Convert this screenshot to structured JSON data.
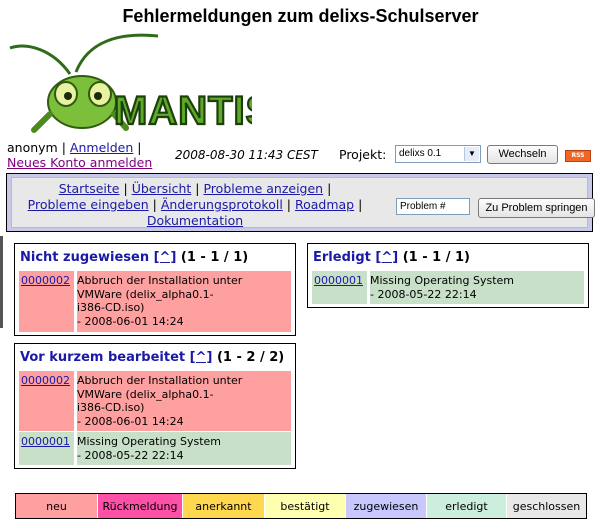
{
  "header": {
    "title": "Fehlermeldungen zum delixs-Schulserver"
  },
  "logo": {
    "text": "MANTIS"
  },
  "login": {
    "user": "anonym",
    "sep1": "|",
    "login_link": "Anmelden",
    "sep2": "|",
    "register_link": "Neues Konto anmelden"
  },
  "status": {
    "datetime": "2008-08-30 11:43 CEST",
    "project_label": "Projekt:",
    "project_value": "delixs 0.1",
    "switch_button": "Wechseln",
    "rss": "RSS"
  },
  "menu": {
    "items": [
      "Startseite",
      "Übersicht",
      "Probleme anzeigen",
      "Probleme eingeben",
      "Änderungsprotokoll",
      "Roadmap",
      "Dokumentation"
    ],
    "separator": "|",
    "problem_placeholder": "Problem #",
    "jump_button": "Zu Problem springen"
  },
  "panels": {
    "unassigned": {
      "title": "Nicht zugewiesen",
      "link": "[^]",
      "count": "(1 - 1 / 1)",
      "rows": [
        {
          "id": "0000002",
          "lines": [
            "Abbruch der Installation unter",
            "VMWare (delix_alpha0.1-",
            "i386-CD.iso)",
            "- 2008-06-01 14:24"
          ],
          "color": "#ffa0a0"
        }
      ]
    },
    "resolved": {
      "title": "Erledigt",
      "link": "[^]",
      "count": "(1 - 1 / 1)",
      "rows": [
        {
          "id": "0000001",
          "lines": [
            "Missing Operating System",
            "- 2008-05-22 22:14"
          ],
          "color": "#c8e0c8"
        }
      ]
    },
    "recent": {
      "title": "Vor kurzem bearbeitet",
      "link": "[^]",
      "count": "(1 - 2 / 2)",
      "rows": [
        {
          "id": "0000002",
          "lines": [
            "Abbruch der Installation unter",
            "VMWare (delix_alpha0.1-",
            "i386-CD.iso)",
            "- 2008-06-01 14:24"
          ],
          "color": "#ffa0a0"
        },
        {
          "id": "0000001",
          "lines": [
            "Missing Operating System",
            "- 2008-05-22 22:14"
          ],
          "color": "#c8e0c8"
        }
      ]
    }
  },
  "legend": [
    {
      "label": "neu",
      "color": "#ffa0a0"
    },
    {
      "label": "Rückmeldung",
      "color": "#ff50a8"
    },
    {
      "label": "anerkannt",
      "color": "#ffd850"
    },
    {
      "label": "bestätigt",
      "color": "#ffffb0"
    },
    {
      "label": "zugewiesen",
      "color": "#c8c8ff"
    },
    {
      "label": "erledigt",
      "color": "#cceedd"
    },
    {
      "label": "geschlossen",
      "color": "#e8e8e8"
    }
  ]
}
